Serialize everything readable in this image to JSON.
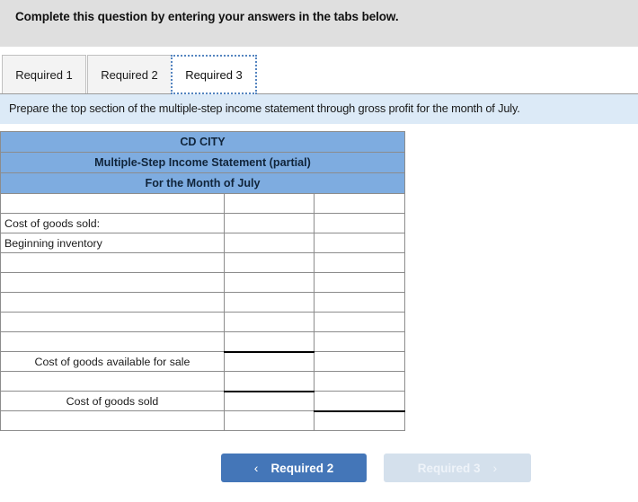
{
  "header": {
    "title": "Complete this question by entering your answers in the tabs below.",
    "background": "#dfdfdf"
  },
  "tabs": {
    "items": [
      {
        "label": "Required 1",
        "active": false
      },
      {
        "label": "Required 2",
        "active": false
      },
      {
        "label": "Required 3",
        "active": true
      }
    ],
    "active_index": 2,
    "focus_border_color": "#5585c0"
  },
  "instruction": {
    "text": "Prepare the top section of the multiple-step income statement through gross profit for the month of July.",
    "background": "#dceaf7"
  },
  "worksheet": {
    "header_background": "#7eace0",
    "title_lines": [
      "CD CITY",
      "Multiple-Step Income Statement (partial)",
      "For the Month of July"
    ],
    "columns": [
      "label",
      "amount_1",
      "amount_2"
    ],
    "rows": [
      {
        "label": "",
        "style": "plain",
        "amount_1": "",
        "amount_2": "",
        "rule_amount_1": false,
        "rule_amount_2": false
      },
      {
        "label": "Cost of goods sold:",
        "style": "plain",
        "amount_1": "",
        "amount_2": "",
        "rule_amount_1": false,
        "rule_amount_2": false
      },
      {
        "label": "Beginning inventory",
        "style": "indent",
        "amount_1": "",
        "amount_2": "",
        "rule_amount_1": false,
        "rule_amount_2": false
      },
      {
        "label": "",
        "style": "plain",
        "amount_1": "",
        "amount_2": "",
        "rule_amount_1": false,
        "rule_amount_2": false
      },
      {
        "label": "",
        "style": "plain",
        "amount_1": "",
        "amount_2": "",
        "rule_amount_1": false,
        "rule_amount_2": false
      },
      {
        "label": "",
        "style": "plain",
        "amount_1": "",
        "amount_2": "",
        "rule_amount_1": false,
        "rule_amount_2": false
      },
      {
        "label": "",
        "style": "plain",
        "amount_1": "",
        "amount_2": "",
        "rule_amount_1": false,
        "rule_amount_2": false
      },
      {
        "label": "",
        "style": "plain",
        "amount_1": "",
        "amount_2": "",
        "rule_amount_1": false,
        "rule_amount_2": false
      },
      {
        "label": "Cost of goods available for sale",
        "style": "center",
        "amount_1": "",
        "amount_2": "",
        "rule_amount_1": true,
        "rule_amount_2": false
      },
      {
        "label": "",
        "style": "plain",
        "amount_1": "",
        "amount_2": "",
        "rule_amount_1": false,
        "rule_amount_2": false
      },
      {
        "label": "Cost of goods sold",
        "style": "center",
        "amount_1": "",
        "amount_2": "",
        "rule_amount_1": true,
        "rule_amount_2": false
      },
      {
        "label": "",
        "style": "plain",
        "amount_1": "",
        "amount_2": "",
        "rule_amount_1": false,
        "rule_amount_2": true
      }
    ]
  },
  "navigation": {
    "prev": {
      "label": "Required 2",
      "icon": "chevron-left-icon",
      "glyph": "‹",
      "enabled": true,
      "color": "#4476b8"
    },
    "next": {
      "label": "Required 3",
      "icon": "chevron-right-icon",
      "glyph": "›",
      "enabled": false,
      "color": "#d4e0ec"
    }
  }
}
